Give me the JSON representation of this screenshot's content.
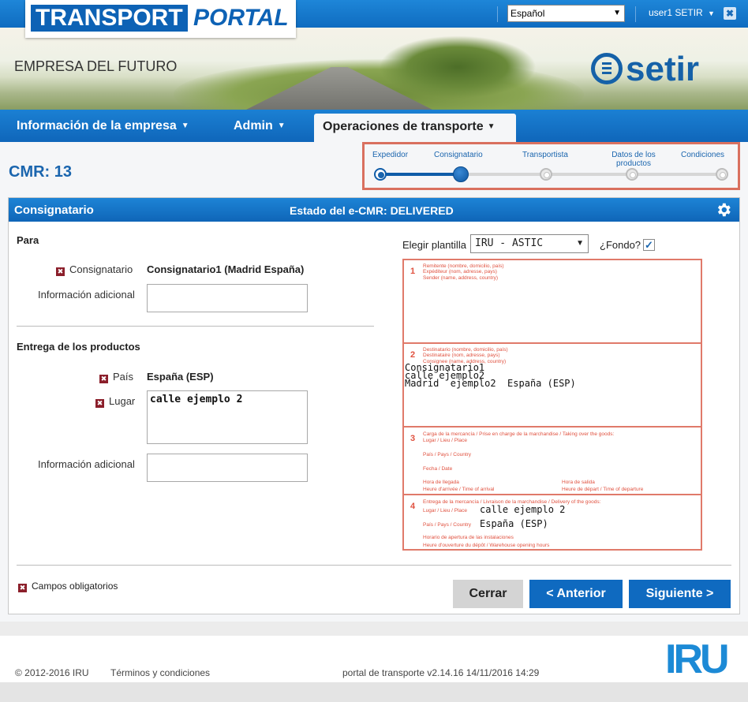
{
  "header": {
    "logo_part1": "TRANSPORT",
    "logo_part2": "PORTAL",
    "language": "Español",
    "user": "user1 SETIR",
    "close_symbol": "✖"
  },
  "banner": {
    "company": "EMPRESA DEL FUTURO",
    "brand": "setir"
  },
  "nav": {
    "items": [
      {
        "label": "Información de la empresa"
      },
      {
        "label": "Admin"
      },
      {
        "label": "Operaciones de transporte"
      }
    ]
  },
  "page": {
    "cmr_title": "CMR: 13"
  },
  "steps": {
    "items": [
      {
        "label": "Expedidor",
        "state": "done"
      },
      {
        "label": "Consignatario",
        "state": "current"
      },
      {
        "label": "Transportista",
        "state": "pending"
      },
      {
        "label": "Datos de los productos",
        "state": "pending"
      },
      {
        "label": "Condiciones",
        "state": "pending"
      }
    ]
  },
  "panel": {
    "title": "Consignatario",
    "status": "Estado del e-CMR: DELIVERED",
    "para": {
      "heading": "Para",
      "consignee_label": "Consignatario",
      "consignee_value": "Consignatario1 (Madrid España)",
      "info_label": "Información adicional",
      "info_value": ""
    },
    "delivery": {
      "heading": "Entrega de los productos",
      "country_label": "País",
      "country_value": "España (ESP)",
      "place_label": "Lugar",
      "place_value": "calle ejemplo 2",
      "info_label": "Información adicional",
      "info_value": ""
    },
    "template": {
      "label": "Elegir plantilla",
      "value": "IRU - ASTIC",
      "background_label": "¿Fondo?",
      "background_checked": true,
      "check_symbol": "✓"
    },
    "cmr_form": {
      "box1": {
        "number": "1",
        "lines": [
          "Remitente (nombre, domicilio, país)",
          "Expéditeur (nom, adresse, pays)",
          "Sender (name, address, country)"
        ]
      },
      "box2": {
        "number": "2",
        "lines": [
          "Destinatario (nombre, domicilio, país)",
          "Destinataire (nom, adresse, pays)",
          "Consignee (name, address, country)"
        ],
        "content": [
          "Consignatario1",
          "calle ejemplo2",
          "Madrid  ejemplo2  España (ESP)"
        ]
      },
      "box3": {
        "number": "3",
        "header": "Carga de la mercancía / Prise en charge de la marchandise / Taking over the goods:",
        "place": "Lugar / Lieu / Place",
        "country": "País / Pays / Country",
        "date": "Fecha / Date",
        "arrival_1": "Hora de llegada",
        "arrival_2": "Heure d'arrivée / Time of arrival",
        "departure_1": "Hora de salida",
        "departure_2": "Heure de départ / Time of departure"
      },
      "box4": {
        "number": "4",
        "header": "Entrega de la mercancía / Livraison de la marchandise / Delivery of the goods:",
        "place": "Lugar / Lieu / Place",
        "place_value": "calle ejemplo 2",
        "country": "País / Pays / Country",
        "country_value": "España (ESP)",
        "hours_1": "Horario de apertura de las instalaciones",
        "hours_2": "Heure d'ouverture du dépôt / Warehouse opening hours"
      }
    },
    "required_note": "Campos obligatorios",
    "required_symbol": "✖",
    "buttons": {
      "close": "Cerrar",
      "prev": "< Anterior",
      "next": "Siguiente >"
    }
  },
  "footer": {
    "copyright": "© 2012-2016 IRU",
    "terms": "Términos y condiciones",
    "version": "portal de transporte v2.14.16 14/11/2016 14:29",
    "logo": "IRU"
  },
  "colors": {
    "primary_blue": "#0f6ac0",
    "highlight_red": "#d9705f",
    "required_red": "#8b1e2a"
  }
}
